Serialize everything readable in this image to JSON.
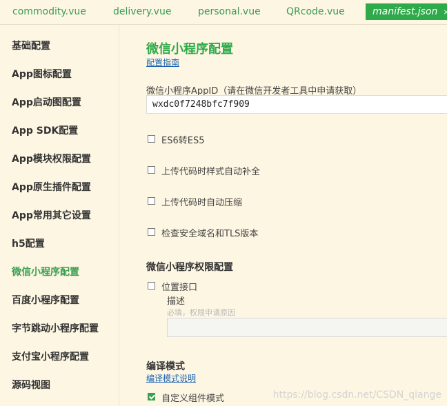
{
  "tabs": [
    {
      "label": "commodity.vue"
    },
    {
      "label": "delivery.vue"
    },
    {
      "label": "personal.vue"
    },
    {
      "label": "QRcode.vue"
    },
    {
      "label": "manifest.json",
      "close": "×",
      "active": true
    }
  ],
  "sidebar": {
    "items": [
      {
        "label": "基础配置"
      },
      {
        "label": "App图标配置"
      },
      {
        "label": "App启动图配置"
      },
      {
        "label": "App SDK配置"
      },
      {
        "label": "App模块权限配置"
      },
      {
        "label": "App原生插件配置"
      },
      {
        "label": "App常用其它设置"
      },
      {
        "label": "h5配置"
      },
      {
        "label": "微信小程序配置",
        "active": true
      },
      {
        "label": "百度小程序配置"
      },
      {
        "label": "字节跳动小程序配置"
      },
      {
        "label": "支付宝小程序配置"
      },
      {
        "label": "源码视图"
      }
    ]
  },
  "main": {
    "title": "微信小程序配置",
    "guide_link": "配置指南",
    "appid_label": "微信小程序AppID（请在微信开发者工具中申请获取）",
    "appid_value": "wxdc0f7248bfc7f909",
    "options": [
      {
        "label": "ES6转ES5",
        "checked": false
      },
      {
        "label": "上传代码时样式自动补全",
        "checked": false
      },
      {
        "label": "上传代码时自动压缩",
        "checked": false
      },
      {
        "label": "检查安全域名和TLS版本",
        "checked": false
      }
    ],
    "permissions_title": "微信小程序权限配置",
    "location": {
      "label": "位置接口",
      "checked": false,
      "desc_label": "描述",
      "desc_hint": "必填，权限申请原因",
      "desc_value": ""
    },
    "compile_title": "编译模式",
    "compile_link": "编译模式说明",
    "custom_component": {
      "label": "自定义组件模式",
      "checked": true
    }
  },
  "watermark": "https://blog.csdn.net/CSDN_qiange",
  "colors": {
    "accent": "#2faa4a",
    "link": "#1a63b5",
    "background": "#fdf6e3"
  }
}
